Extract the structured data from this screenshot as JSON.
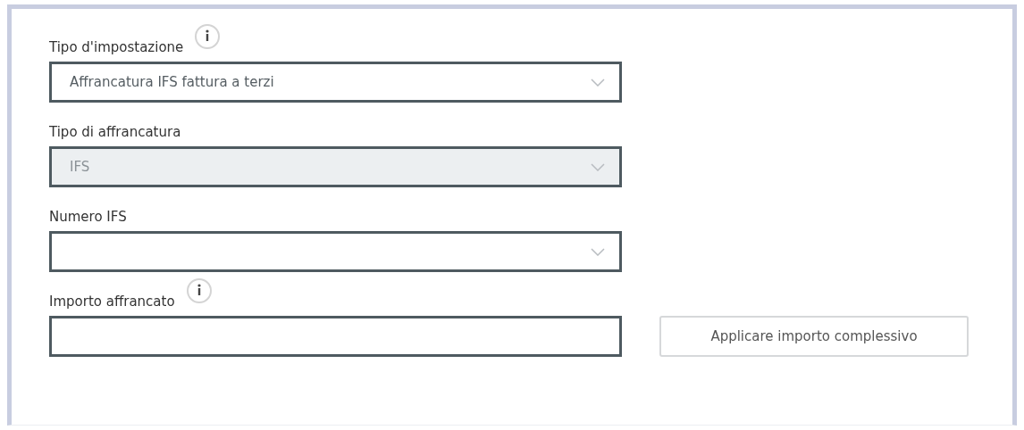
{
  "fields": [
    {
      "kind": "select",
      "label": "Tipo d'impostazione",
      "info": true,
      "disabled": false,
      "value": "Affrancatura IFS fattura a terzi"
    },
    {
      "kind": "select",
      "label": "Tipo di affrancatura",
      "info": false,
      "disabled": true,
      "value": "IFS"
    },
    {
      "kind": "select",
      "label": "Numero IFS",
      "info": false,
      "disabled": false
    },
    {
      "kind": "input",
      "label": "Importo affrancato",
      "info": true,
      "disabled": false,
      "button": "Applicare importo complessivo"
    }
  ]
}
